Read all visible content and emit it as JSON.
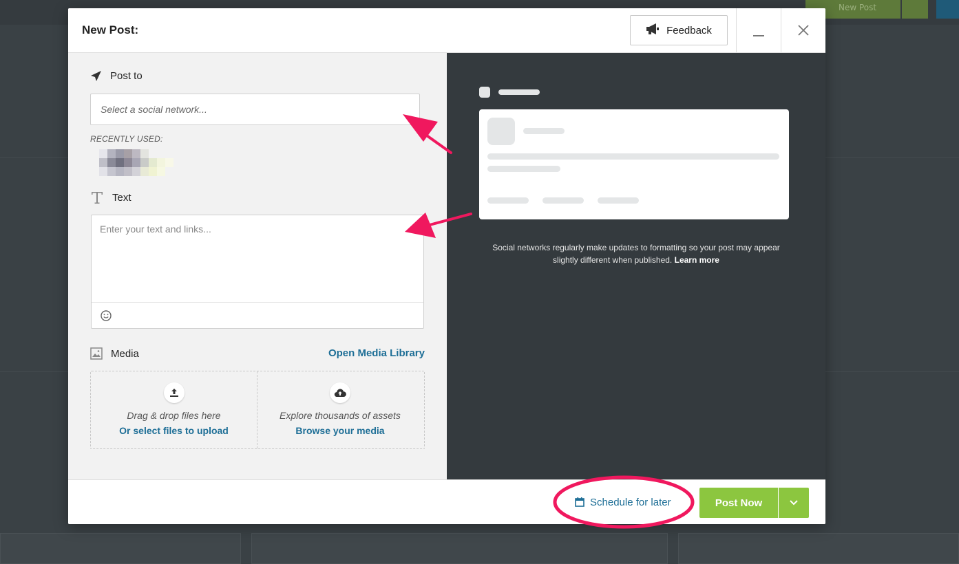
{
  "background": {
    "new_post_label": "New Post"
  },
  "modal": {
    "title": "New Post:",
    "feedback_label": "Feedback"
  },
  "post_to": {
    "label": "Post to",
    "placeholder": "Select a social network...",
    "recently_used_label": "RECENTLY USED:"
  },
  "text": {
    "label": "Text",
    "placeholder": "Enter your text and links..."
  },
  "media": {
    "label": "Media",
    "open_library": "Open Media Library",
    "upload_hint": "Drag & drop files here",
    "upload_link": "Or select files to upload",
    "browse_hint": "Explore thousands of assets",
    "browse_link": "Browse your media"
  },
  "preview": {
    "note": "Social networks regularly make updates to formatting so your post may appear slightly different when published.",
    "learn_more": "Learn more"
  },
  "footer": {
    "schedule_label": "Schedule for later",
    "post_now_label": "Post Now"
  },
  "colors": {
    "accent_blue": "#1d6e96",
    "post_green": "#8cc63f",
    "preview_bg": "#343a3e",
    "annotation_pink": "#f0185e"
  },
  "icons": [
    "megaphone-icon",
    "minimize-icon",
    "close-icon",
    "paper-plane-icon",
    "text-t-icon",
    "emoji-icon",
    "image-icon",
    "upload-icon",
    "cloud-upload-icon",
    "calendar-icon",
    "chevron-down-icon"
  ]
}
